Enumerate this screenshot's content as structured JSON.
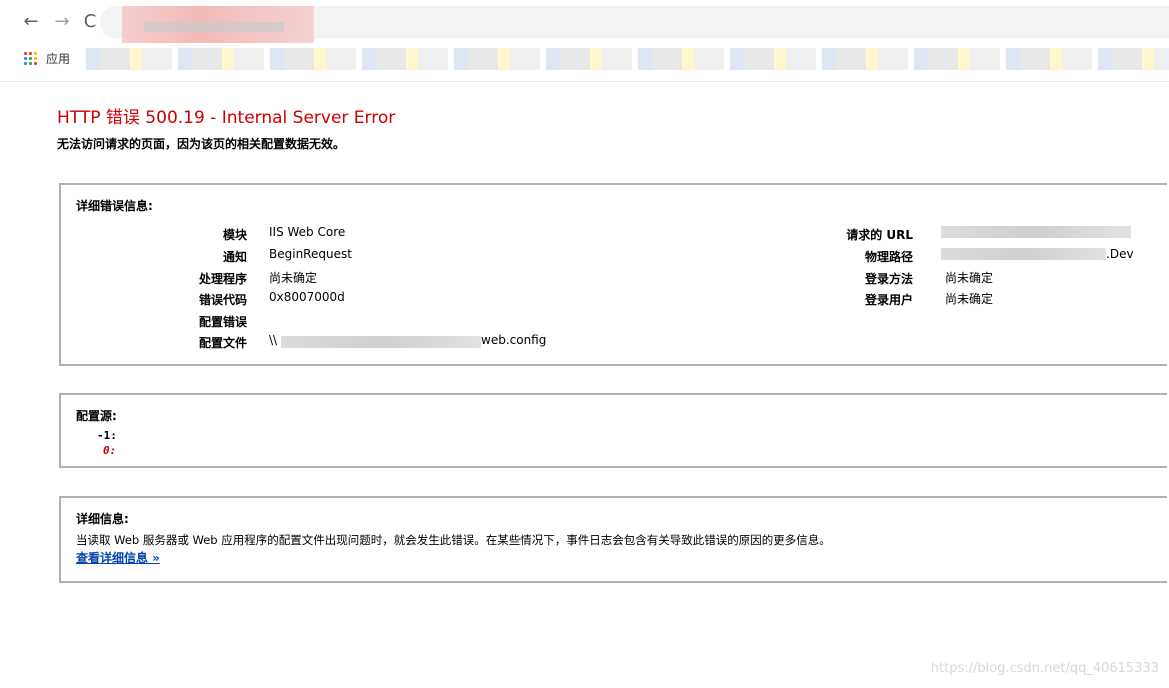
{
  "browser": {
    "back_icon": "←",
    "forward_icon": "→",
    "reload_icon": "C",
    "bookmarks_bar": {
      "apps_label": "应用"
    }
  },
  "error_page": {
    "title": "HTTP 错误 500.19 - Internal Server Error",
    "subtitle": "无法访问请求的页面，因为该页的相关配置数据无效。",
    "detailed_error": {
      "heading": "详细错误信息:",
      "left": [
        {
          "label": "模块",
          "value": "IIS Web Core"
        },
        {
          "label": "通知",
          "value": "BeginRequest"
        },
        {
          "label": "处理程序",
          "value": "尚未确定"
        },
        {
          "label": "错误代码",
          "value": "0x8007000d"
        },
        {
          "label": "配置错误",
          "value": ""
        },
        {
          "label": "配置文件",
          "value_prefix": "\\\\",
          "value_suffix": "web.config"
        }
      ],
      "right": [
        {
          "label": "请求的 URL",
          "value": ""
        },
        {
          "label": "物理路径",
          "value_suffix": "Dev"
        },
        {
          "label": "登录方法",
          "value": "尚未确定"
        },
        {
          "label": "登录用户",
          "value": "尚未确定"
        }
      ]
    },
    "config_source": {
      "heading": "配置源:",
      "line1": "-1:",
      "line2": "0:"
    },
    "more_info": {
      "heading": "详细信息:",
      "text": "当读取 Web 服务器或 Web 应用程序的配置文件出现问题时，就会发生此错误。在某些情况下，事件日志会包含有关导致此错误的原因的更多信息。",
      "link": "查看详细信息 »"
    }
  },
  "watermark": "https://blog.csdn.net/qq_40615333",
  "colors": {
    "title": "#cc0000",
    "link": "#0645ad",
    "panel_border": "#b0b0b0"
  }
}
